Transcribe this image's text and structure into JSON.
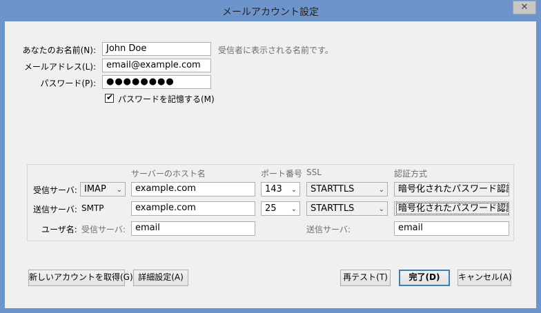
{
  "window": {
    "title": "メールアカウント設定",
    "close_glyph": "✕"
  },
  "identity": {
    "name_label": "あなたのお名前(N):",
    "name_value": "John Doe",
    "name_hint": "受信者に表示される名前です。",
    "email_label": "メールアドレス(L):",
    "email_value": "email@example.com",
    "password_label": "パスワード(P):",
    "password_value": "●●●●●●●●",
    "remember_label": "パスワードを記憶する(M)",
    "remember_checked": true,
    "check_glyph": "✔"
  },
  "server": {
    "headers": {
      "host": "サーバーのホスト名",
      "port": "ポート番号",
      "ssl": "SSL",
      "auth": "認証方式"
    },
    "incoming": {
      "label": "受信サーバ:",
      "protocol": "IMAP",
      "host": "example.com",
      "port": "143",
      "ssl": "STARTTLS",
      "auth": "暗号化されたパスワード認証"
    },
    "outgoing": {
      "label": "送信サーバ:",
      "protocol": "SMTP",
      "host": "example.com",
      "port": "25",
      "ssl": "STARTTLS",
      "auth": "暗号化されたパスワード認証"
    },
    "username": {
      "label": "ユーザ名:",
      "incoming_label": "受信サーバ:",
      "incoming_value": "email",
      "outgoing_label": "送信サーバ:",
      "outgoing_value": "email"
    },
    "arrow_glyph": "⌄"
  },
  "buttons": {
    "new_account": "新しいアカウントを取得(G)",
    "advanced": "詳細設定(A)",
    "retest": "再テスト(T)",
    "done": "完了(D)",
    "cancel": "キャンセル(A)"
  }
}
